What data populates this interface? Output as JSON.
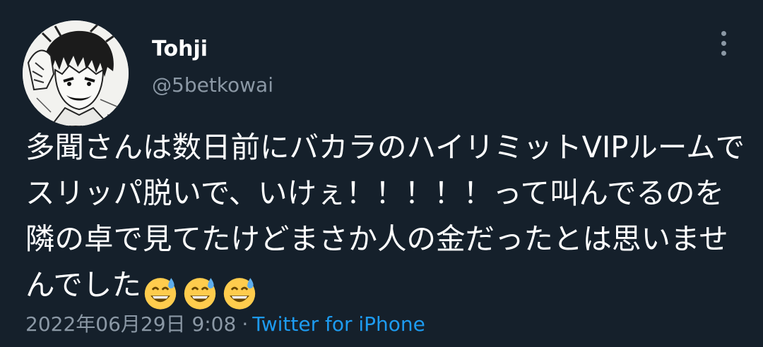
{
  "user": {
    "display_name": "Tohji",
    "handle": "@5betkowai"
  },
  "tweet": {
    "text": "多聞さんは数日前にバカラのハイリミットVIPルームでスリッパ脱いで、いけぇ！！！！！って叫んでるのを隣の卓で見てたけどまさか人の金だったとは思いませんでした",
    "emojis": [
      "grinning-face-with-sweat",
      "grinning-face-with-sweat",
      "grinning-face-with-sweat"
    ]
  },
  "meta": {
    "date": "2022年06月29日",
    "time": "9:08",
    "separator": "·",
    "source": "Twitter for iPhone"
  },
  "colors": {
    "background": "#15202b",
    "text": "#ffffff",
    "secondary": "#8b98a5",
    "link": "#1d9bf0"
  },
  "icons": {
    "more": "more-vertical-icon"
  }
}
